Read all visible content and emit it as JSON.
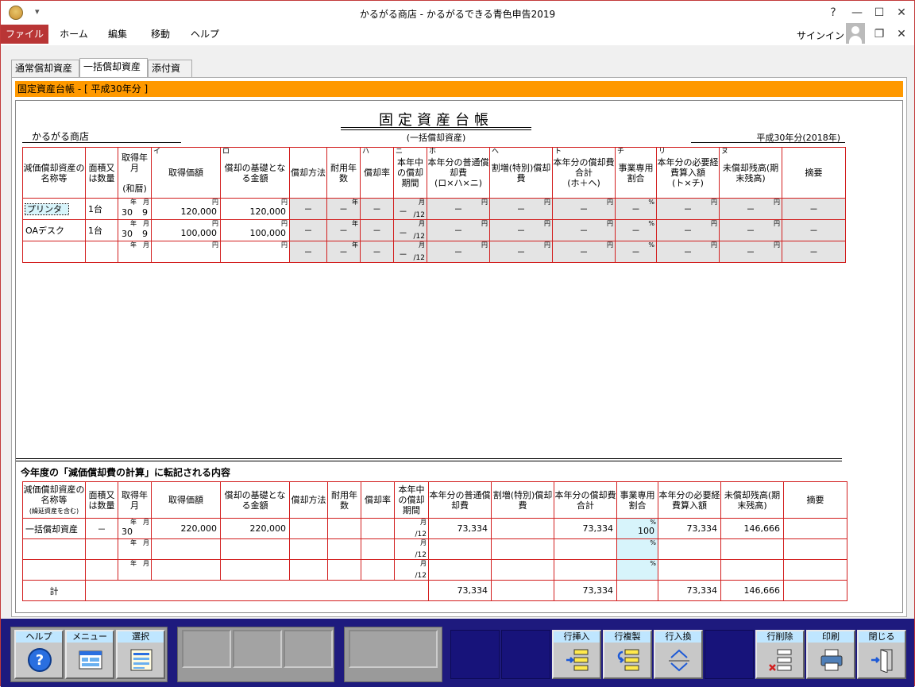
{
  "window": {
    "title": "かるがる商店 - かるがるできる青色申告2019",
    "controls": {
      "help": "?",
      "minimize": "—",
      "maximize": "☐",
      "close": "✕",
      "restore": "❐",
      "close2": "✕"
    }
  },
  "ribbon": {
    "tabs": [
      "ファイル",
      "ホーム",
      "編集",
      "移動",
      "ヘルプ"
    ],
    "signin": "サインイン"
  },
  "tabs": [
    "通常償却資産",
    "一括償却資産",
    "添付資料"
  ],
  "header_bar": "固定資産台帳 - [ 平成30年分 ]",
  "doc": {
    "title": "固定資産台帳",
    "subtitle": "(一括償却資産)",
    "shop": "かるがる商店",
    "year": "平成30年分(2018年)"
  },
  "table1": {
    "markers": {
      "i": "イ",
      "ro": "ロ",
      "ha": "ハ",
      "ni": "ニ",
      "ho": "ホ",
      "he": "ヘ",
      "to": "ト",
      "chi": "チ",
      "ri": "リ",
      "nu": "ヌ"
    },
    "headers": {
      "name": "減価償却資産の名称等",
      "qty": "面積又は数量",
      "acq": "取得年月",
      "acq_note": "(和暦)",
      "price": "取得価額",
      "base": "償却の基礎となる金額",
      "method": "償却方法",
      "life": "耐用年数",
      "rate": "償却率",
      "months": "本年中の償却期間",
      "normal": "本年分の普通償却費",
      "normal_note": "(ロ×ハ×ニ)",
      "special": "割増(特別)償却費",
      "total": "本年分の償却費合計",
      "total_note": "(ホ＋ヘ)",
      "biz": "事業専用割合",
      "exp": "本年分の必要経費算入額",
      "exp_note": "(ト×チ)",
      "remain": "未償却残高(期末残高)",
      "memo": "摘要"
    },
    "units": {
      "year": "年",
      "month": "月",
      "yen": "円",
      "pct": "%",
      "per12": "/12",
      "dash": "－"
    },
    "rows": [
      {
        "name": "プリンタ",
        "qty": "1台",
        "y": "30",
        "m": "9",
        "price": "120,000",
        "base": "120,000"
      },
      {
        "name": "OAデスク",
        "qty": "1台",
        "y": "30",
        "m": "9",
        "price": "100,000",
        "base": "100,000"
      },
      {
        "name": "",
        "qty": "",
        "y": "",
        "m": "",
        "price": "",
        "base": ""
      }
    ]
  },
  "section2_title": "今年度の「減価償却費の計算」に転記される内容",
  "table2": {
    "headers": {
      "name": "減価償却資産の名称等",
      "name_note": "(繰延資産を含む)",
      "qty": "面積又は数量",
      "acq": "取得年月",
      "price": "取得価額",
      "base": "償却の基礎となる金額",
      "method": "償却方法",
      "life": "耐用年数",
      "rate": "償却率",
      "months": "本年中の償却期間",
      "normal": "本年分の普通償却費",
      "special": "割増(特別)償却費",
      "total": "本年分の償却費合計",
      "biz": "事業専用割合",
      "exp": "本年分の必要経費算入額",
      "remain": "未償却残高(期末残高)",
      "memo": "摘要"
    },
    "rows": [
      {
        "name": "一括償却資産",
        "qty": "－",
        "y": "30",
        "price": "220,000",
        "base": "220,000",
        "normal": "73,334",
        "total": "73,334",
        "biz": "100",
        "exp": "73,334",
        "remain": "146,666"
      },
      {
        "name": "",
        "qty": "",
        "y": "",
        "price": "",
        "base": "",
        "normal": "",
        "total": "",
        "biz": "",
        "exp": "",
        "remain": ""
      },
      {
        "name": "",
        "qty": "",
        "y": "",
        "price": "",
        "base": "",
        "normal": "",
        "total": "",
        "biz": "",
        "exp": "",
        "remain": ""
      }
    ],
    "total": {
      "label": "計",
      "normal": "73,334",
      "total": "73,334",
      "exp": "73,334",
      "remain": "146,666"
    }
  },
  "buttons": {
    "help": "ヘルプ",
    "menu": "メニュー",
    "select": "選択",
    "insert": "行挿入",
    "copy": "行複製",
    "swap": "行入換",
    "delete": "行削除",
    "print": "印刷",
    "close": "閉じる"
  }
}
